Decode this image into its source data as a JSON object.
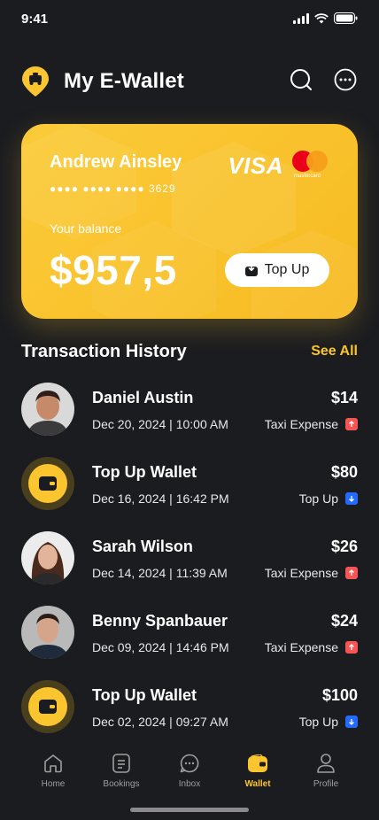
{
  "status_bar": {
    "time": "9:41"
  },
  "header": {
    "title": "My E-Wallet",
    "logo_icon": "taxi-pin-icon",
    "search_icon": "search-icon",
    "more_icon": "more-icon"
  },
  "card": {
    "holder": "Andrew Ainsley",
    "number": "●●●● ●●●● ●●●● 3629",
    "brand": "VISA",
    "mastercard_label": "mastercard",
    "balance_label": "Your balance",
    "balance": "$957,5",
    "topup_label": "Top Up",
    "accent": "#f9c22c"
  },
  "transactions": {
    "title": "Transaction History",
    "see_all": "See All",
    "items": [
      {
        "name": "Daniel Austin",
        "date": "Dec 20, 2024 | 10:00 AM",
        "amount": "$14",
        "type": "Taxi Expense",
        "direction": "out",
        "avatar": "person"
      },
      {
        "name": "Top Up Wallet",
        "date": "Dec 16, 2024 | 16:42 PM",
        "amount": "$80",
        "type": "Top Up",
        "direction": "in",
        "avatar": "wallet"
      },
      {
        "name": "Sarah Wilson",
        "date": "Dec 14, 2024 | 11:39 AM",
        "amount": "$26",
        "type": "Taxi Expense",
        "direction": "out",
        "avatar": "person"
      },
      {
        "name": "Benny Spanbauer",
        "date": "Dec 09, 2024 | 14:46 PM",
        "amount": "$24",
        "type": "Taxi Expense",
        "direction": "out",
        "avatar": "person"
      },
      {
        "name": "Top Up Wallet",
        "date": "Dec 02, 2024 | 09:27 AM",
        "amount": "$100",
        "type": "Top Up",
        "direction": "in",
        "avatar": "wallet"
      }
    ]
  },
  "nav": {
    "items": [
      {
        "label": "Home",
        "icon": "home-icon"
      },
      {
        "label": "Bookings",
        "icon": "document-icon"
      },
      {
        "label": "Inbox",
        "icon": "chat-icon"
      },
      {
        "label": "Wallet",
        "icon": "wallet-icon",
        "active": true
      },
      {
        "label": "Profile",
        "icon": "profile-icon"
      }
    ]
  },
  "colors": {
    "background": "#1b1c20",
    "accent": "#fbc52f",
    "red": "#f75555",
    "blue": "#246bfd"
  }
}
